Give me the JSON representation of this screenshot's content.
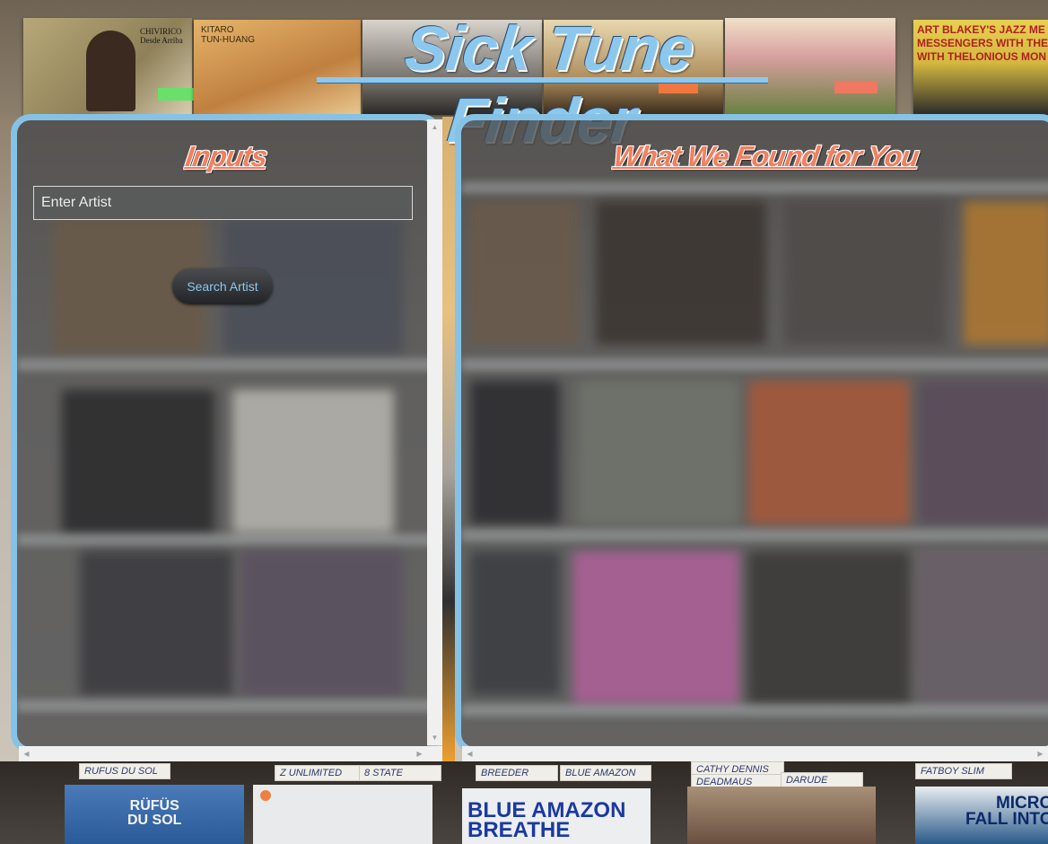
{
  "app": {
    "title": "Sick Tune Finder"
  },
  "inputs_panel": {
    "heading": "Inputs",
    "artist_input": {
      "placeholder": "Enter Artist",
      "value": ""
    },
    "search_button_label": "Search Artist"
  },
  "results_panel": {
    "heading": "What We Found for You"
  },
  "background": {
    "top_albums": [
      {
        "text": "CHIVIRICO\nDesde Arriba",
        "color": "#c6b98a"
      },
      {
        "text": "KITARO\nTUN-HUANG",
        "color": "#d29a50"
      },
      {
        "text": "ART BLAKEY'S JAZZ ME\nMESSENGERS WITH THE\nWITH THELONIOUS MON",
        "color": "#e0c050"
      }
    ],
    "bin_cards": [
      "RUFUS DU SOL",
      "Z UNLIMITED",
      "8 STATE",
      "BREEDER",
      "BLUE AMAZON",
      "CATHY DENNIS",
      "DEADMAUS",
      "DARUDE",
      "FATBOY SLIM"
    ],
    "bin_sleeves": [
      {
        "text": "RÜFÜS\nDU SOL",
        "color": "#3a6aa8"
      },
      {
        "text": "BLUE AMAZON\nBREATHE",
        "color": "#e8e8ec"
      },
      {
        "text": "MICRO\nFALL INTO ME",
        "color": "#e8e8ec"
      }
    ]
  },
  "colors": {
    "accent_blue": "#86c2e6",
    "heading_coral": "#f08060",
    "panel_bg": "#46484a"
  },
  "icons": {
    "scroll_up": "scroll-up-arrow-icon",
    "scroll_down": "scroll-down-arrow-icon",
    "scroll_left": "scroll-left-arrow-icon",
    "scroll_right": "scroll-right-arrow-icon"
  }
}
